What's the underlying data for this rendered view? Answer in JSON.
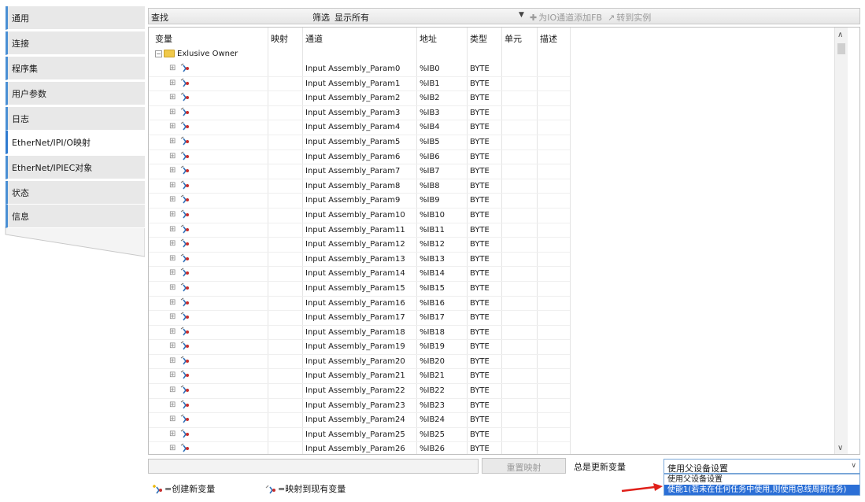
{
  "sidebar": {
    "items": [
      {
        "label": "通用"
      },
      {
        "label": "连接"
      },
      {
        "label": "程序集"
      },
      {
        "label": "用户参数"
      },
      {
        "label": "日志"
      },
      {
        "label": "EtherNet/IPI/O映射",
        "active": true
      },
      {
        "label": "EtherNet/IPIEC对象"
      },
      {
        "label": "状态"
      },
      {
        "label": "信息"
      }
    ]
  },
  "toolbar": {
    "find_label": "查找",
    "filter_label": "筛选",
    "filter_value": "显示所有",
    "add_fb_label": "为IO通道添加FB",
    "goto_instance_label": "转到实例"
  },
  "grid": {
    "columns": [
      "变量",
      "映射",
      "通道",
      "地址",
      "类型",
      "单元",
      "描述"
    ],
    "group_label": "Exlusive Owner",
    "rows": [
      {
        "channel": "Input Assembly_Param0",
        "address": "%IB0",
        "type": "BYTE"
      },
      {
        "channel": "Input Assembly_Param1",
        "address": "%IB1",
        "type": "BYTE"
      },
      {
        "channel": "Input Assembly_Param2",
        "address": "%IB2",
        "type": "BYTE"
      },
      {
        "channel": "Input Assembly_Param3",
        "address": "%IB3",
        "type": "BYTE"
      },
      {
        "channel": "Input Assembly_Param4",
        "address": "%IB4",
        "type": "BYTE"
      },
      {
        "channel": "Input Assembly_Param5",
        "address": "%IB5",
        "type": "BYTE"
      },
      {
        "channel": "Input Assembly_Param6",
        "address": "%IB6",
        "type": "BYTE"
      },
      {
        "channel": "Input Assembly_Param7",
        "address": "%IB7",
        "type": "BYTE"
      },
      {
        "channel": "Input Assembly_Param8",
        "address": "%IB8",
        "type": "BYTE"
      },
      {
        "channel": "Input Assembly_Param9",
        "address": "%IB9",
        "type": "BYTE"
      },
      {
        "channel": "Input Assembly_Param10",
        "address": "%IB10",
        "type": "BYTE"
      },
      {
        "channel": "Input Assembly_Param11",
        "address": "%IB11",
        "type": "BYTE"
      },
      {
        "channel": "Input Assembly_Param12",
        "address": "%IB12",
        "type": "BYTE"
      },
      {
        "channel": "Input Assembly_Param13",
        "address": "%IB13",
        "type": "BYTE"
      },
      {
        "channel": "Input Assembly_Param14",
        "address": "%IB14",
        "type": "BYTE"
      },
      {
        "channel": "Input Assembly_Param15",
        "address": "%IB15",
        "type": "BYTE"
      },
      {
        "channel": "Input Assembly_Param16",
        "address": "%IB16",
        "type": "BYTE"
      },
      {
        "channel": "Input Assembly_Param17",
        "address": "%IB17",
        "type": "BYTE"
      },
      {
        "channel": "Input Assembly_Param18",
        "address": "%IB18",
        "type": "BYTE"
      },
      {
        "channel": "Input Assembly_Param19",
        "address": "%IB19",
        "type": "BYTE"
      },
      {
        "channel": "Input Assembly_Param20",
        "address": "%IB20",
        "type": "BYTE"
      },
      {
        "channel": "Input Assembly_Param21",
        "address": "%IB21",
        "type": "BYTE"
      },
      {
        "channel": "Input Assembly_Param22",
        "address": "%IB22",
        "type": "BYTE"
      },
      {
        "channel": "Input Assembly_Param23",
        "address": "%IB23",
        "type": "BYTE"
      },
      {
        "channel": "Input Assembly_Param24",
        "address": "%IB24",
        "type": "BYTE"
      },
      {
        "channel": "Input Assembly_Param25",
        "address": "%IB25",
        "type": "BYTE"
      },
      {
        "channel": "Input Assembly_Param26",
        "address": "%IB26",
        "type": "BYTE"
      }
    ]
  },
  "bottom": {
    "reset_mapping_label": "重置映射",
    "always_update_label": "总是更新变量",
    "update_select_value": "使用父设备设置",
    "dropdown_options": [
      {
        "label": "使用父设备设置"
      },
      {
        "label": "使能1(若未在任何任务中使用,则使用总线周期任务)",
        "selected": true
      }
    ]
  },
  "legend": {
    "new_variable": "=创建新变量",
    "existing_variable": "=映射到现有变量"
  },
  "colors": {
    "accent": "#2b6fd6",
    "tab_border": "#4a8fd4",
    "annotation_arrow": "#e0201a"
  }
}
